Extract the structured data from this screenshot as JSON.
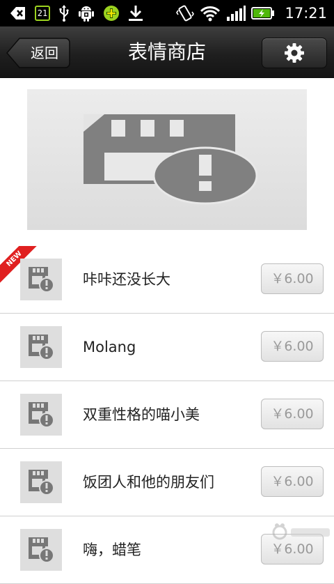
{
  "status_bar": {
    "time": "17:21",
    "calendar_day": "21",
    "icons": [
      "back-arrow-icon",
      "calendar-icon",
      "usb-icon",
      "android-icon",
      "app-plus-icon",
      "download-icon",
      "vibrate-icon",
      "wifi-icon",
      "signal-icon",
      "battery-charging-icon"
    ],
    "accent_green": "#9bd21f"
  },
  "title_bar": {
    "back_label": "返回",
    "title": "表情商店",
    "settings_icon": "gear-icon"
  },
  "banner": {
    "icon": "sd-card-error-icon"
  },
  "items": [
    {
      "name": "咔咔还没长大",
      "price": "￥6.00",
      "badge": "NEW",
      "icon": "sd-card-error-icon"
    },
    {
      "name": "Molang",
      "price": "￥6.00",
      "icon": "sd-card-error-icon"
    },
    {
      "name": "双重性格的喵小美",
      "price": "￥6.00",
      "icon": "sd-card-error-icon"
    },
    {
      "name": "饭团人和他的朋友们",
      "price": "￥6.00",
      "icon": "sd-card-error-icon"
    },
    {
      "name": "嗨，蜡笔",
      "price": "￥6.00",
      "icon": "sd-card-error-icon"
    }
  ],
  "colors": {
    "badge_red": "#e02020",
    "price_text": "#9a9a9a",
    "placeholder_gray": "#808080"
  }
}
